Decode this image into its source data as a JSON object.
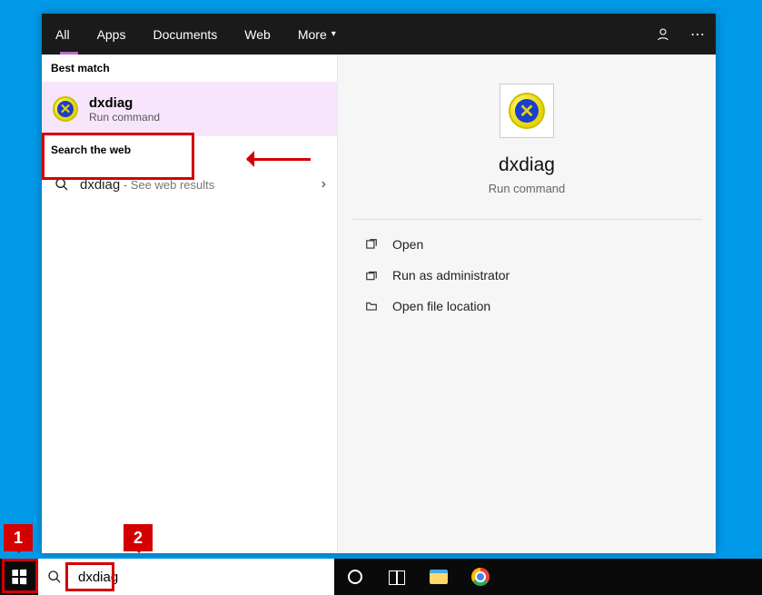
{
  "tabs": {
    "all": "All",
    "apps": "Apps",
    "documents": "Documents",
    "web": "Web",
    "more": "More"
  },
  "sections": {
    "best_match": "Best match",
    "search_web": "Search the web"
  },
  "best": {
    "title": "dxdiag",
    "subtitle": "Run command"
  },
  "web": {
    "term": "dxdiag",
    "suffix": " - See web results"
  },
  "preview": {
    "title": "dxdiag",
    "subtitle": "Run command"
  },
  "actions": {
    "open": "Open",
    "run_admin": "Run as administrator",
    "open_loc": "Open file location"
  },
  "search": {
    "value": "dxdiag"
  },
  "callouts": {
    "one": "1",
    "two": "2"
  }
}
